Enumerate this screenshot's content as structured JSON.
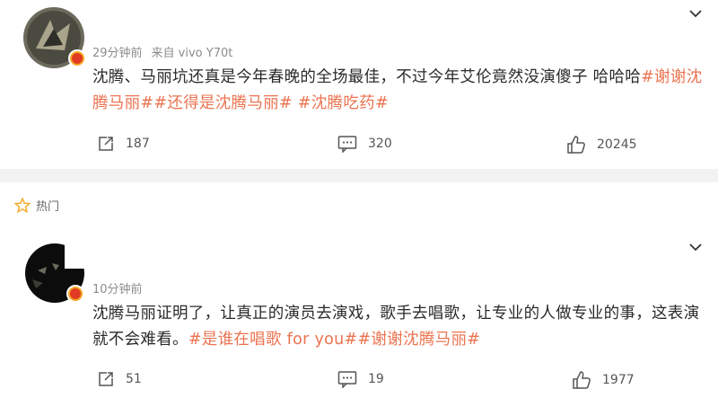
{
  "posts": [
    {
      "time": "29分钟前",
      "source": "来自 vivo Y70t",
      "text_plain": "沈腾、马丽坑还真是今年春晚的全场最佳，不过今年艾伦竟然没演傻子 哈哈哈",
      "tag1": "#谢谢沈",
      "line2_tags": [
        "腾马丽#",
        "#还得是沈腾马丽#",
        "#沈腾吃药#"
      ],
      "reposts": "187",
      "comments": "320",
      "likes": "20245"
    },
    {
      "hot_label": "热门",
      "time": "10分钟前",
      "line1": "沈腾马丽证明了，让真正的演员去演戏，歌手去唱歌，让专业的人做专业的事，这表演",
      "line2_plain": "就不会难看。",
      "line2_tags": [
        "#是谁在唱歌 for you#",
        "#谢谢沈腾马丽#"
      ],
      "reposts": "51",
      "comments": "19",
      "likes": "1977"
    }
  ],
  "icons": [
    "chevron-down-icon",
    "repost-icon",
    "comment-icon",
    "like-icon",
    "hot-flame-icon",
    "verified-badge-icon"
  ],
  "colors": {
    "tag": "#eb7350",
    "meta": "#8c8c8c",
    "badge": "#f5a623"
  }
}
